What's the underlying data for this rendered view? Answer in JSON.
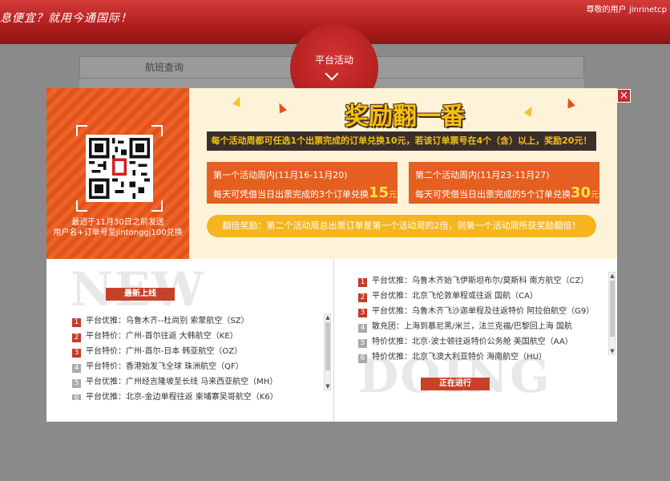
{
  "header": {
    "slogan": "息便宜？就用今通国际！",
    "user_prefix": "尊敬的用户",
    "username": "jinrinetcp"
  },
  "background": {
    "tab_flight_search": "航班查询",
    "platform_activity": "平台活动"
  },
  "promo": {
    "headline": "奖励翻一番",
    "rule": "每个活动周都可任选1个出票完成的订单兑换10元，若该订单票号在4个（含）以上，奖励20元！",
    "note_line1": "最迟于11月30日之前发送",
    "note_line2": "用户名+订单号至jintonggj100兑换",
    "week1_title": "第一个活动周内(11月16-11月20)",
    "week1_desc": "每天可凭借当日出票完成的3个订单兑换",
    "week1_amount": "15",
    "week2_title": "第二个活动周内(11月23-11月27)",
    "week2_desc": "每天可凭借当日出票完成的5个订单兑换",
    "week2_amount": "30",
    "currency": "元",
    "bonus": "翻倍奖励：第二个活动周总出票订单是第一个活动周的2倍，则第一个活动周所获奖励翻倍！"
  },
  "new_panel": {
    "watermark": "NEW",
    "tag": "最新上线",
    "items": [
      {
        "num": "1",
        "text": "平台优推：乌鲁木齐--杜尚别 索蒙航空（SZ）"
      },
      {
        "num": "2",
        "text": "平台特价：广州-首尔往返 大韩航空（KE）"
      },
      {
        "num": "3",
        "text": "平台特价：广州-首尔-日本 韩亚航空（OZ）"
      },
      {
        "num": "4",
        "text": "平台特价：香港始发飞全球 珠洲航空（QF）"
      },
      {
        "num": "5",
        "text": "平台优推：广州经吉隆坡至长线 马来西亚航空（MH）"
      },
      {
        "num": "6",
        "text": "平台优推：北京-金边单程往返 柬埔寨吴哥航空（K6）"
      }
    ]
  },
  "doing_panel": {
    "watermark": "DOING",
    "tag": "正在进行",
    "items": [
      {
        "num": "1",
        "text": "平台优推：乌鲁木齐始飞伊斯坦布尔/莫斯科 南方航空（CZ）"
      },
      {
        "num": "2",
        "text": "平台优推：北京飞伦敦单程或往返 国航（CA）"
      },
      {
        "num": "3",
        "text": "平台优推：乌鲁木齐飞沙迦单程及往返特价 阿拉伯航空（G9）"
      },
      {
        "num": "4",
        "text": "散充团：上海到慕尼黑/米兰，法兰克福/巴黎回上海 国航"
      },
      {
        "num": "5",
        "text": "特价优推：北京-波士顿往返特价公务舱 美国航空（AA）"
      },
      {
        "num": "6",
        "text": "特价优推：北京飞澳大利亚特价 海南航空（HU）"
      }
    ]
  },
  "colors": {
    "brand_red": "#c62a2a",
    "promo_orange": "#e55f20",
    "gold": "#f3c112",
    "bonus_yellow": "#f6b51f"
  }
}
